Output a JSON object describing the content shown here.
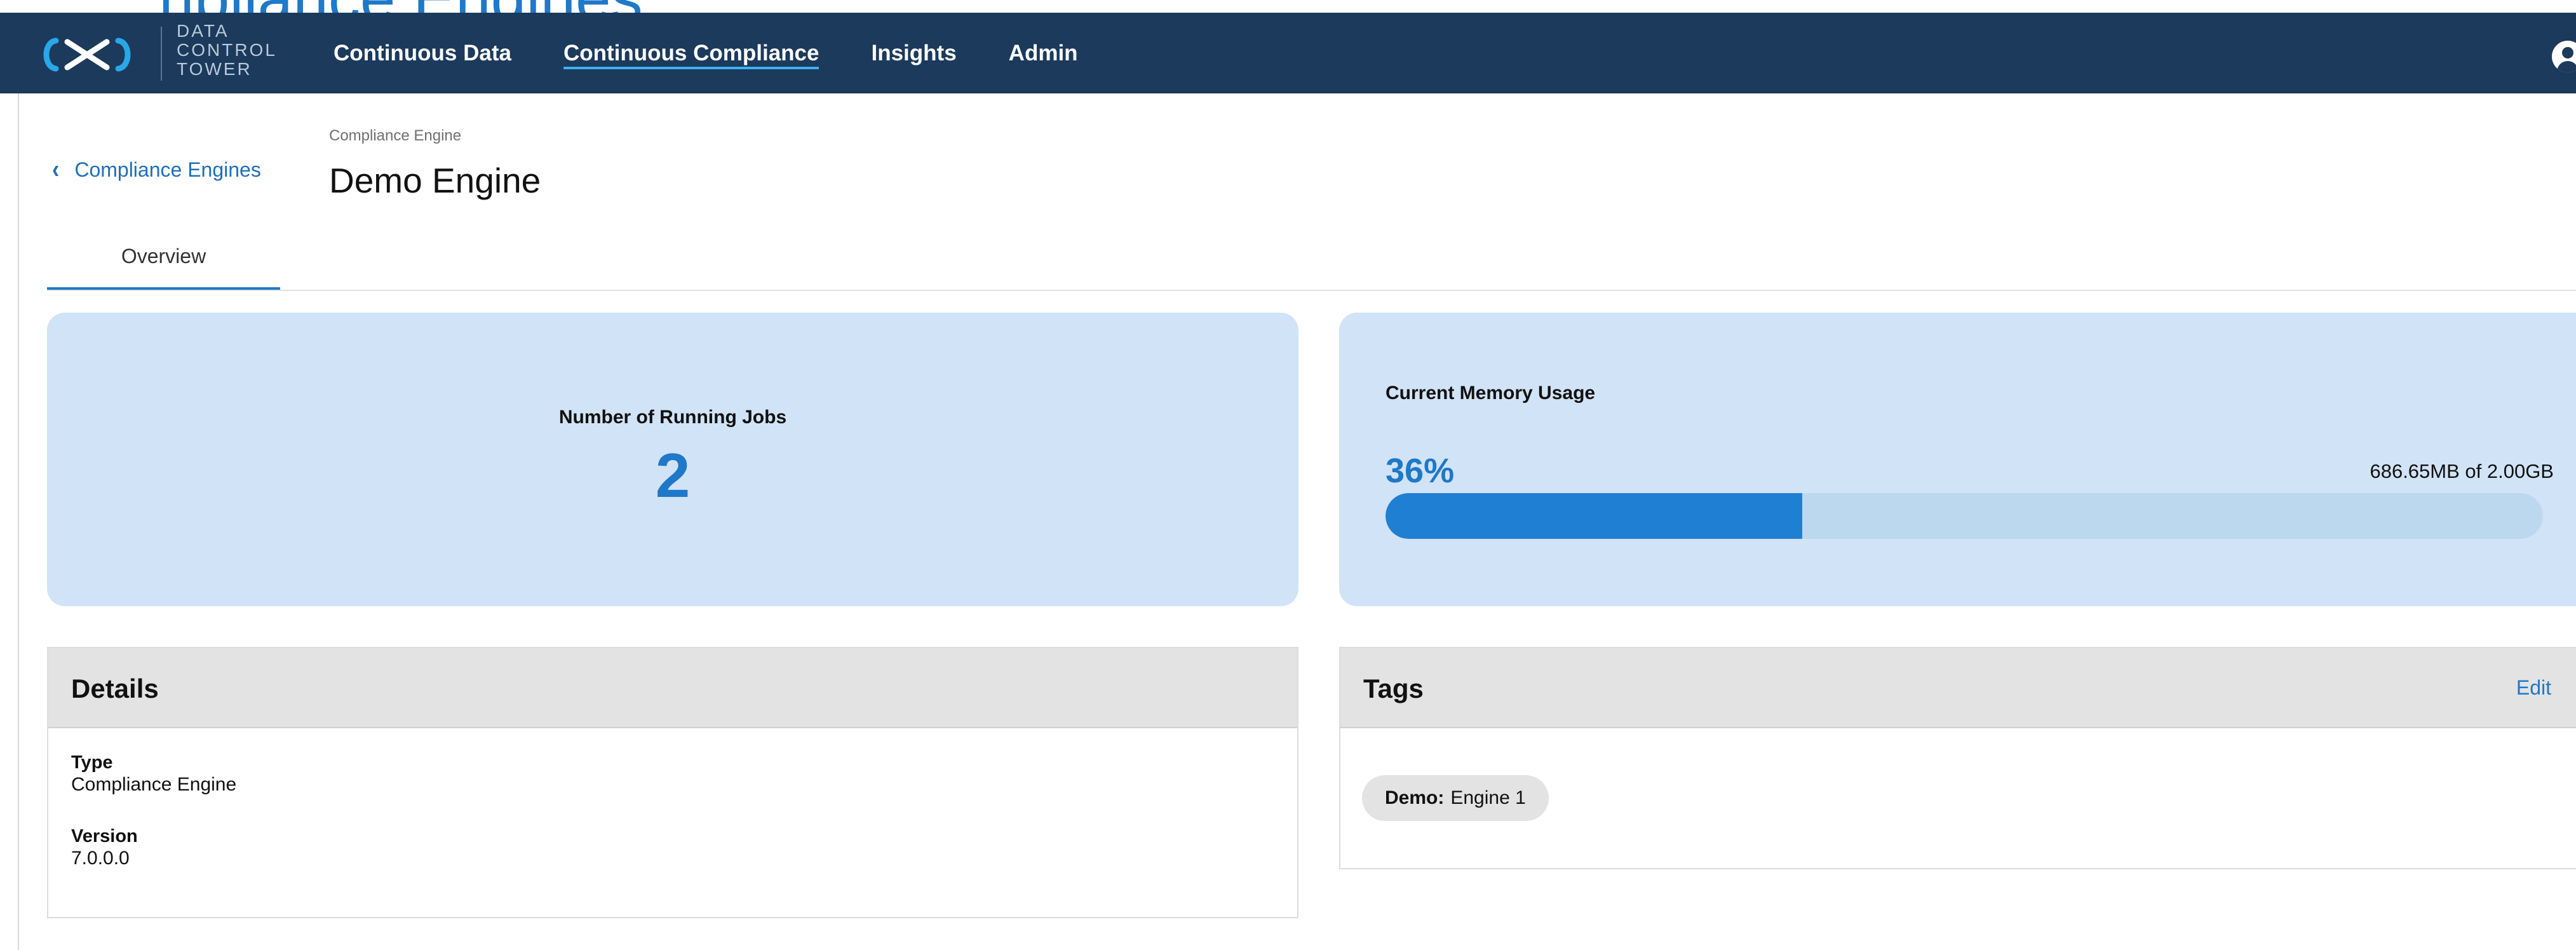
{
  "top_fragment": "npliance Engines",
  "logo": {
    "lines": [
      "DATA",
      "CONTROL",
      "TOWER"
    ],
    "icon": "infinity-logo-icon"
  },
  "nav": {
    "items": [
      {
        "label": "Continuous Data",
        "active": false
      },
      {
        "label": "Continuous Compliance",
        "active": true
      },
      {
        "label": "Insights",
        "active": false
      },
      {
        "label": "Admin",
        "active": false
      }
    ],
    "user_icon": "user-avatar-icon"
  },
  "header": {
    "back_label": "Compliance Engines",
    "breadcrumb": "Compliance Engine",
    "title": "Demo Engine"
  },
  "tabs": [
    {
      "label": "Overview",
      "active": true
    }
  ],
  "stats": {
    "running_jobs": {
      "label": "Number of Running Jobs",
      "value": "2"
    },
    "memory": {
      "label": "Current Memory Usage",
      "percent_text": "36%",
      "percent": 0.36,
      "usage_text": "686.65MB of 2.00GB"
    }
  },
  "details": {
    "title": "Details",
    "fields": [
      {
        "label": "Type",
        "value": "Compliance Engine"
      },
      {
        "label": "Version",
        "value": "7.0.0.0"
      }
    ]
  },
  "tags": {
    "title": "Tags",
    "edit_label": "Edit",
    "items": [
      {
        "key": "Demo:",
        "value": "Engine 1"
      }
    ]
  },
  "colors": {
    "nav_bg": "#1b3a5c",
    "accent": "#1f78c8",
    "card_bg": "#d1e3f6",
    "panel_head_bg": "#e3e3e3"
  }
}
